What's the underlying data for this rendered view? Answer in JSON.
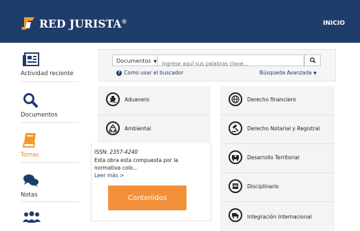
{
  "header": {
    "brand": "RED JURISTA",
    "brand_mark": "®",
    "nav_home": "INICIO"
  },
  "sidebar": {
    "items": [
      {
        "label": "Actividad reciente",
        "icon": "newspaper-icon"
      },
      {
        "label": "Documentos",
        "icon": "search-icon"
      },
      {
        "label": "Tomas",
        "icon": "book-icon"
      },
      {
        "label": "Notas",
        "icon": "chat-bubbles-icon"
      },
      {
        "label": "",
        "icon": "group-icon"
      }
    ]
  },
  "search": {
    "scope_selected": "Documentos",
    "placeholder": "Ingrese aquí sus palabras clave...",
    "help_link": "Como usar el buscador",
    "advanced": "Búsqueda Avanzada"
  },
  "categories": {
    "left": [
      {
        "label": "Aduanero",
        "icon": "ship-icon"
      },
      {
        "label": "Ambiental",
        "icon": "recycle-icon"
      }
    ],
    "right": [
      {
        "label": "Derecho financiero",
        "icon": "globe-icon"
      },
      {
        "label": "Derecho Notarial y Registral",
        "icon": "gavel-icon"
      },
      {
        "label": "Desarrollo Territorial",
        "icon": "ambulance-icon"
      },
      {
        "label": "Disciplinario",
        "icon": "document-icon"
      },
      {
        "label": "Integración Internacional",
        "icon": "truck-icon"
      }
    ]
  },
  "expanded": {
    "issn_label": "ISSN:",
    "issn_value": "2357-4240",
    "description": "Esta obra esta compuesta por la normativa colo...",
    "read_more": "Leer más >",
    "button": "Contenidos"
  },
  "colors": {
    "header_bg": "#1f3d6b",
    "accent_orange": "#f3913a",
    "link_blue": "#1f3d6b"
  }
}
